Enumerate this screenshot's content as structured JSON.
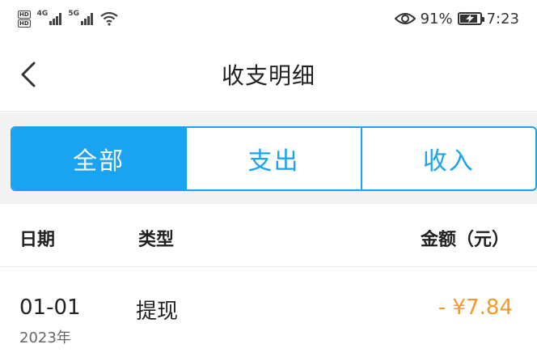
{
  "status_bar": {
    "hd_1": "HD",
    "hd_2": "HD",
    "network_1": "4G",
    "network_2": "5G",
    "battery_percent": "91%",
    "time": "7:23",
    "battery_level": 0.91,
    "icons": [
      "eye-icon",
      "wifi-icon",
      "signal-icon",
      "battery-icon"
    ]
  },
  "nav": {
    "title": "收支明细",
    "back_icon": "chevron-left-icon"
  },
  "tabs": [
    {
      "label": "全部",
      "active": true
    },
    {
      "label": "支出",
      "active": false
    },
    {
      "label": "收入",
      "active": false
    }
  ],
  "table": {
    "headers": {
      "date": "日期",
      "type": "类型",
      "amount": "金额（元）"
    },
    "rows": [
      {
        "date": "01-01",
        "year": "2023年",
        "type": "提现",
        "amount": "- ¥7.84"
      }
    ]
  },
  "colors": {
    "accent": "#19a3f0",
    "amount_negative": "#f59a23",
    "band": "#f2f2f2"
  }
}
